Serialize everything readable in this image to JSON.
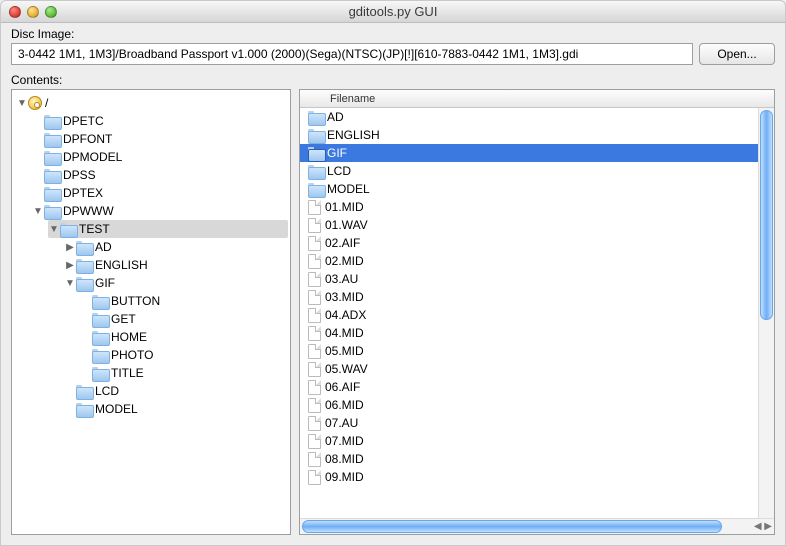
{
  "window": {
    "title": "gditools.py GUI"
  },
  "disc": {
    "label": "Disc Image:",
    "path": "3-0442 1M1, 1M3]/Broadband Passport v1.000 (2000)(Sega)(NTSC)(JP)[!][610-7883-0442 1M1, 1M3].gdi",
    "open_label": "Open..."
  },
  "contents_label": "Contents:",
  "tree": {
    "root_label": "/",
    "items": [
      {
        "label": "DPETC"
      },
      {
        "label": "DPFONT"
      },
      {
        "label": "DPMODEL"
      },
      {
        "label": "DPSS"
      },
      {
        "label": "DPTEX"
      },
      {
        "label": "DPWWW",
        "expanded": true,
        "children": [
          {
            "label": "TEST",
            "expanded": true,
            "selected": true,
            "children": [
              {
                "label": "AD",
                "has_children": true
              },
              {
                "label": "ENGLISH",
                "has_children": true
              },
              {
                "label": "GIF",
                "expanded": true,
                "children": [
                  {
                    "label": "BUTTON"
                  },
                  {
                    "label": "GET"
                  },
                  {
                    "label": "HOME"
                  },
                  {
                    "label": "PHOTO"
                  },
                  {
                    "label": "TITLE"
                  }
                ]
              },
              {
                "label": "LCD"
              },
              {
                "label": "MODEL"
              }
            ]
          }
        ]
      }
    ]
  },
  "list": {
    "header": "Filename",
    "rows": [
      {
        "name": "AD",
        "type": "folder"
      },
      {
        "name": "ENGLISH",
        "type": "folder"
      },
      {
        "name": "GIF",
        "type": "folder",
        "selected": true
      },
      {
        "name": "LCD",
        "type": "folder"
      },
      {
        "name": "MODEL",
        "type": "folder"
      },
      {
        "name": "01.MID",
        "type": "file"
      },
      {
        "name": "01.WAV",
        "type": "file"
      },
      {
        "name": "02.AIF",
        "type": "file"
      },
      {
        "name": "02.MID",
        "type": "file"
      },
      {
        "name": "03.AU",
        "type": "file"
      },
      {
        "name": "03.MID",
        "type": "file"
      },
      {
        "name": "04.ADX",
        "type": "file"
      },
      {
        "name": "04.MID",
        "type": "file"
      },
      {
        "name": "05.MID",
        "type": "file"
      },
      {
        "name": "05.WAV",
        "type": "file"
      },
      {
        "name": "06.AIF",
        "type": "file"
      },
      {
        "name": "06.MID",
        "type": "file"
      },
      {
        "name": "07.AU",
        "type": "file"
      },
      {
        "name": "07.MID",
        "type": "file"
      },
      {
        "name": "08.MID",
        "type": "file"
      },
      {
        "name": "09.MID",
        "type": "file"
      }
    ]
  }
}
